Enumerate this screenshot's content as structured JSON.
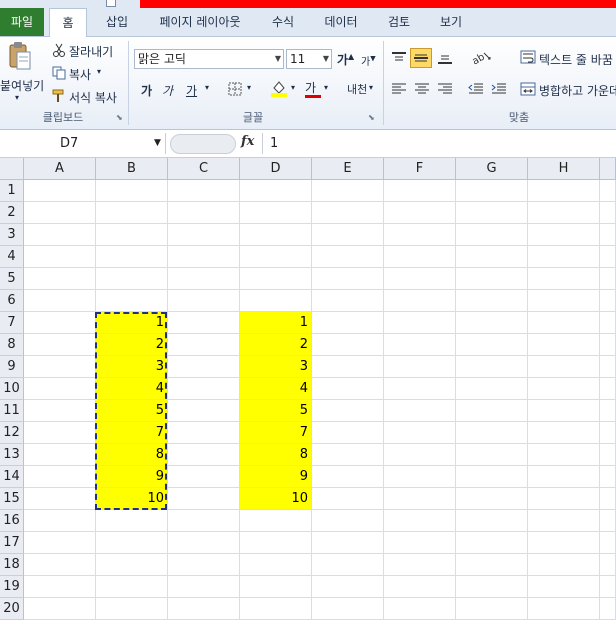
{
  "tabs": [
    {
      "label": "파일"
    },
    {
      "label": "홈"
    },
    {
      "label": "삽입"
    },
    {
      "label": "페이지 레이아웃"
    },
    {
      "label": "수식"
    },
    {
      "label": "데이터"
    },
    {
      "label": "검토"
    },
    {
      "label": "보기"
    }
  ],
  "ribbon": {
    "clipboard": {
      "paste": "붙여넣기",
      "cut": "잘라내기",
      "copy": "복사",
      "format_painter": "서식 복사",
      "group": "클립보드"
    },
    "font": {
      "name": "맑은 고딕",
      "size": "11",
      "bold": "가",
      "italic": "가",
      "underline": "가",
      "font_color": "가",
      "phonetic": "내천",
      "grow": "가",
      "shrink": "가",
      "group": "글꼴"
    },
    "alignment": {
      "wrap_text": "텍스트 줄 바꿈",
      "merge_center": "병합하고 가운데",
      "group": "맞춤"
    }
  },
  "formula_bar": {
    "name_box": "D7",
    "fx": "fx",
    "value": "1"
  },
  "sheet": {
    "columns": [
      "A",
      "B",
      "C",
      "D",
      "E",
      "F",
      "G",
      "H"
    ],
    "rows": [
      "1",
      "2",
      "3",
      "4",
      "5",
      "6",
      "7",
      "8",
      "9",
      "10",
      "11",
      "12",
      "13",
      "14",
      "15",
      "16",
      "17",
      "18",
      "19",
      "20"
    ],
    "column_b_values": [
      "1",
      "2",
      "3",
      "4",
      "5",
      "7",
      "8",
      "9",
      "10"
    ],
    "column_d_values": [
      "1",
      "2",
      "3",
      "4",
      "5",
      "7",
      "8",
      "9",
      "10"
    ],
    "fill_color": "#ffff00",
    "marquee_color": "#1f2f8a"
  },
  "colors": {
    "file_tab": "#2f7d2f",
    "ribbon_bg": "#dfe8f3",
    "title_bar": "#ff0000",
    "highlight": "#ffd965"
  }
}
